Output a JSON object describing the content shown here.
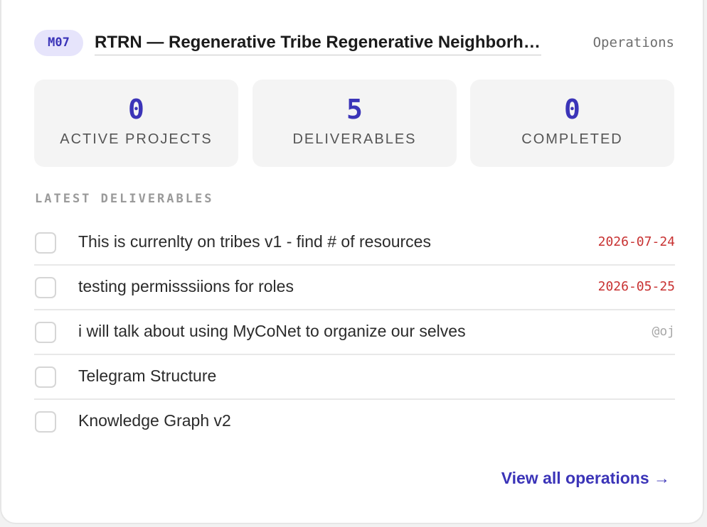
{
  "header": {
    "code": "M07",
    "title": "RTRN — Regenerative Tribe Regenerative Neighborhood",
    "category": "Operations"
  },
  "stats": [
    {
      "value": "0",
      "label": "ACTIVE PROJECTS"
    },
    {
      "value": "5",
      "label": "DELIVERABLES"
    },
    {
      "value": "0",
      "label": "COMPLETED"
    }
  ],
  "deliverables": {
    "section_title": "LATEST DELIVERABLES",
    "items": [
      {
        "text": "This is currenlty on tribes v1 - find # of resources",
        "meta": "2026-07-24",
        "meta_kind": "date",
        "checked": false
      },
      {
        "text": "testing permisssiions for roles",
        "meta": "2026-05-25",
        "meta_kind": "date",
        "checked": false
      },
      {
        "text": "i will talk about using MyCoNet to organize our selves",
        "meta": "@oj",
        "meta_kind": "assignee",
        "checked": false
      },
      {
        "text": "Telegram Structure",
        "meta": "",
        "meta_kind": "none",
        "checked": false
      },
      {
        "text": "Knowledge Graph v2",
        "meta": "",
        "meta_kind": "none",
        "checked": false
      }
    ]
  },
  "footer": {
    "view_all_label": "View all operations →"
  },
  "colors": {
    "accent": "#3b34b8",
    "badge_bg": "#e6e4fb",
    "date_red": "#c83232",
    "muted": "#a8a8a8"
  }
}
